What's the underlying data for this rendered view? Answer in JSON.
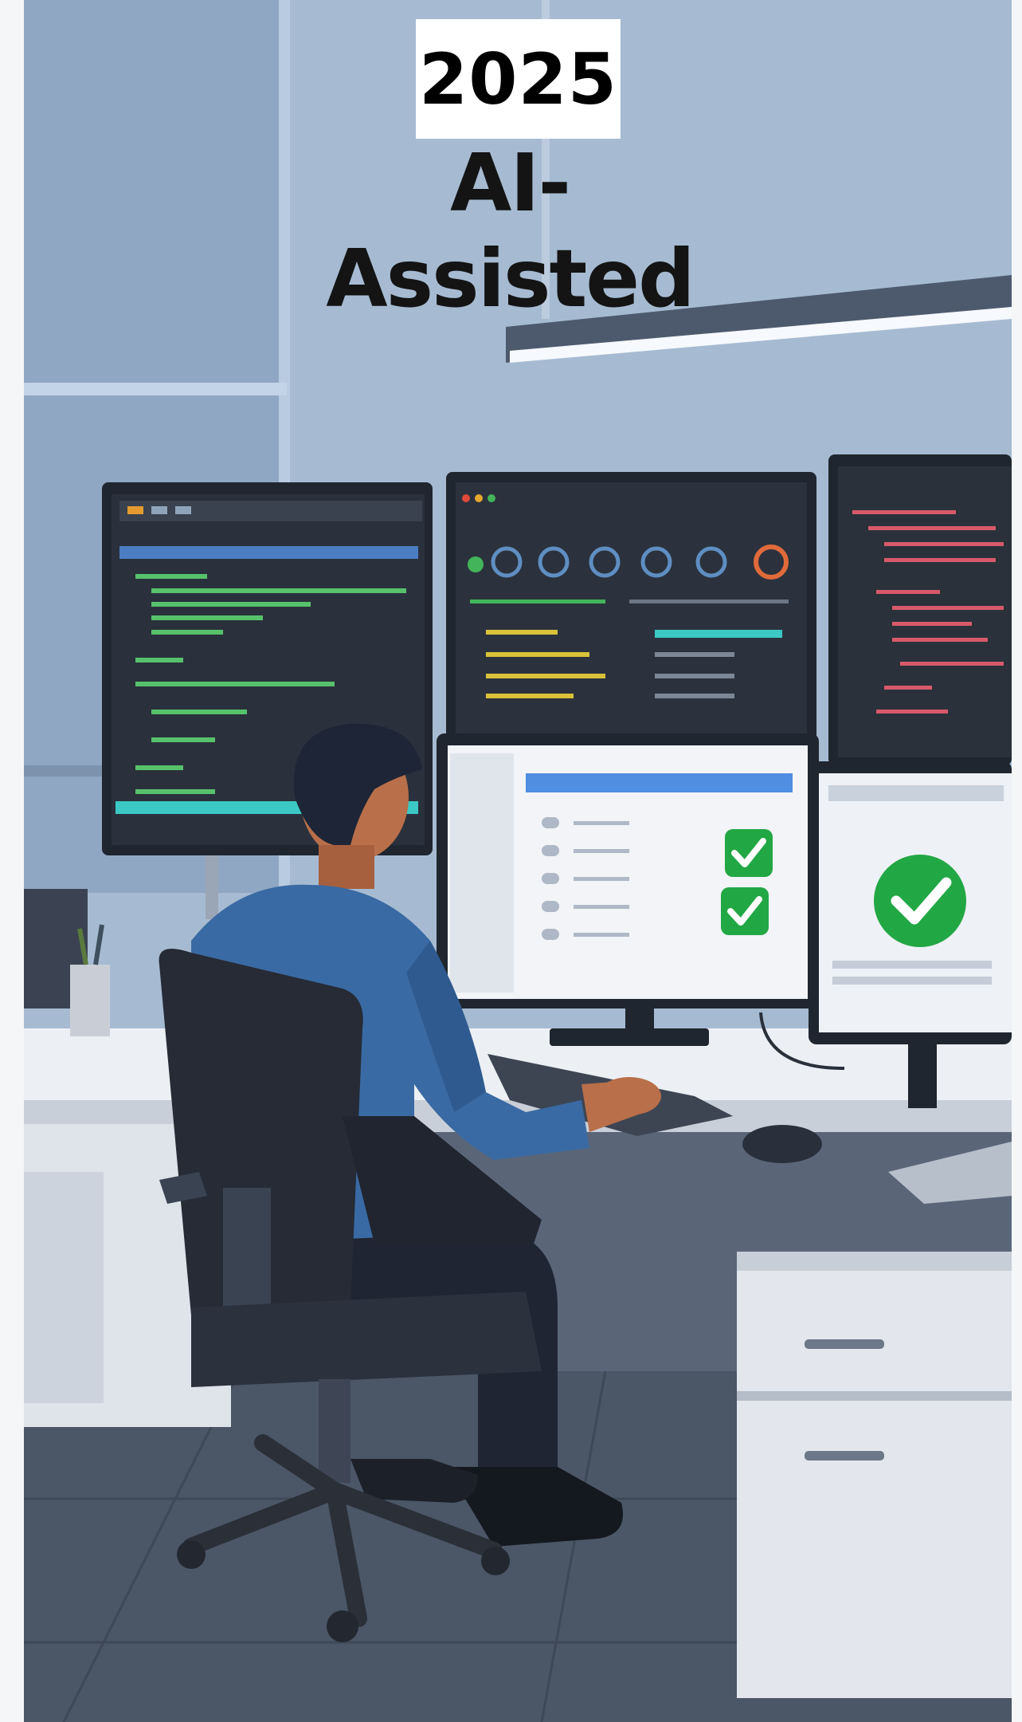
{
  "title_card": {
    "year": "2025",
    "headline": "AI-Assisted"
  },
  "colors": {
    "wall": "#9db3cc",
    "desk": "#e8ebf0",
    "floor": "#4d5868",
    "shirt": "#3a6aa3",
    "check_green": "#22a745",
    "accent_orange": "#e06a3a"
  },
  "icons": {
    "check_small": "check-icon",
    "check_large": "check-circle-icon"
  }
}
